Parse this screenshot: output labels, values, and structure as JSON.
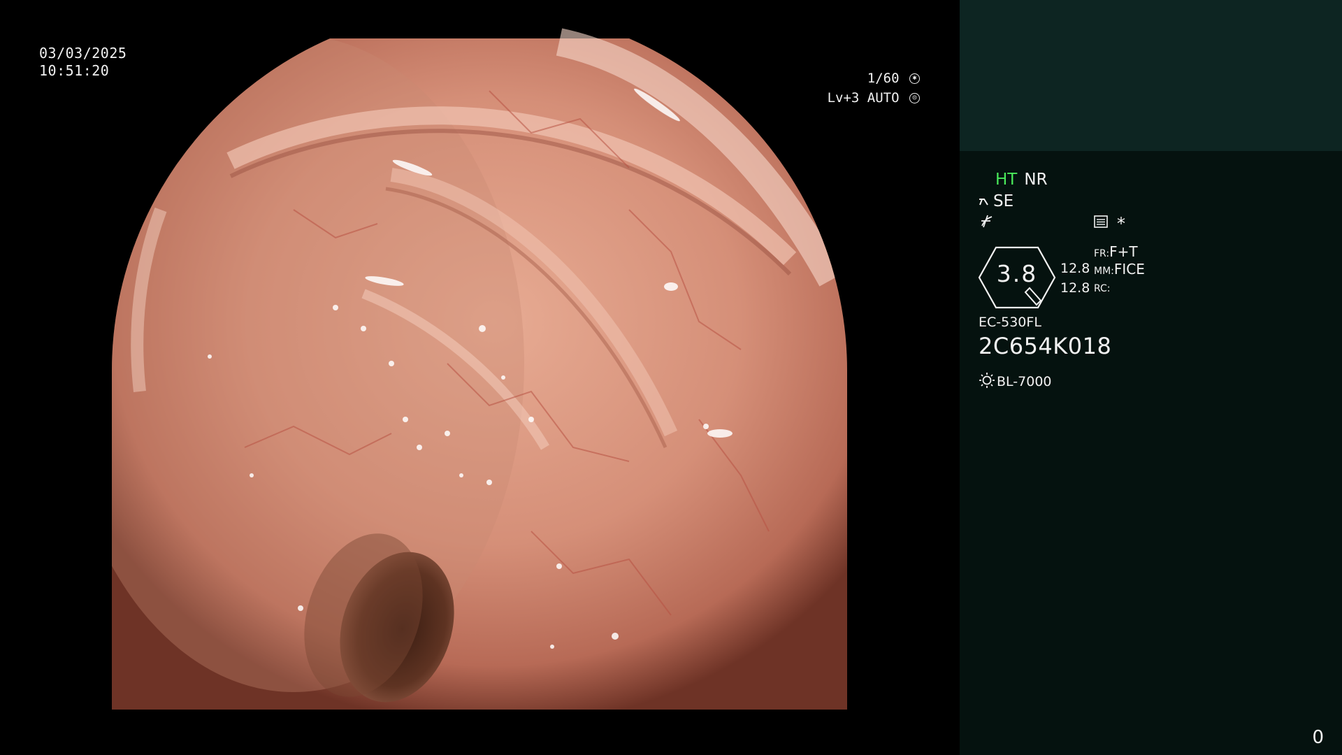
{
  "overlay": {
    "date": "03/03/2025",
    "time": "10:51:20",
    "shutter": "1/60",
    "shutter_icon": "aperture-icon",
    "level": "Lv+3 AUTO",
    "level_icon": "iris-icon"
  },
  "panel": {
    "ht": "HT",
    "nr": "NR",
    "se": "SE",
    "se_icon": "enhance-curve-icon",
    "edge_icon": "edge-icon",
    "menu_icon": "menu-box-icon",
    "star": "*",
    "gauge_value": "3.8",
    "nums": [
      "12.8",
      "12.8"
    ],
    "fr_rows": [
      {
        "key": "FR:",
        "value": "F+T"
      },
      {
        "key": "MM:",
        "value": "FICE"
      },
      {
        "key": "RC:",
        "value": ""
      }
    ],
    "scope_model": "EC-530FL",
    "scope_serial": "2C654K018",
    "light_source": "BL-7000",
    "light_icon": "sun-icon",
    "counter": "0"
  },
  "colors": {
    "panel_top": "#0d2522",
    "panel_bottom": "#05120f",
    "ht_green": "#49e85a",
    "mucosa": "#d99580"
  }
}
